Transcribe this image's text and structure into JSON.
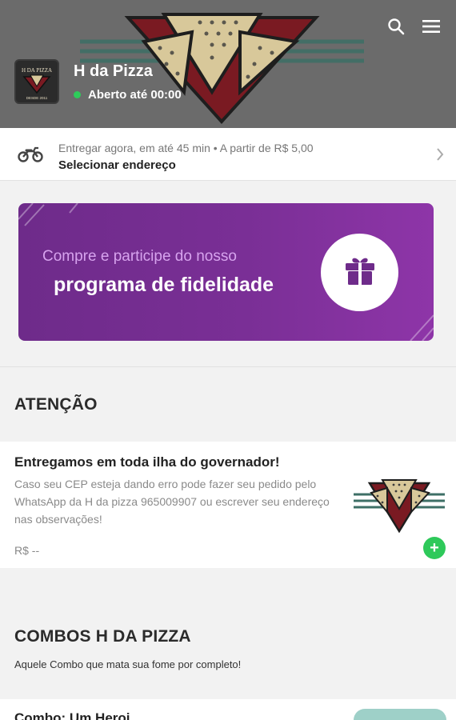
{
  "header": {
    "store_name": "H da Pizza",
    "status": "Aberto até 00:00",
    "status_color": "#2ecc5a",
    "logo_text_top": "H DA PIZZA",
    "logo_text_bottom": "DESDE 2011",
    "icons": [
      "search-icon",
      "menu-icon"
    ]
  },
  "delivery": {
    "line1": "Entregar agora, em até 45 min  •  A partir de R$ 5,00",
    "line2": "Selecionar endereço",
    "icon": "motorcycle-icon"
  },
  "banner": {
    "line1": "Compre e participe do nosso",
    "line2": "programa de fidelidade",
    "icon": "gift-icon",
    "color": "#7a2f96"
  },
  "sections": [
    {
      "title": "ATENÇÃO",
      "subtitle": "",
      "items": [
        {
          "title": "Entregamos em toda ilha do governador!",
          "description": "Caso seu CEP esteja dando erro pode fazer seu pedido pelo WhatsApp da H da pizza 965009907 ou escrever seu endereço nas observações!",
          "price": "R$ --",
          "add_label": "+"
        }
      ]
    },
    {
      "title": "COMBOS H DA PIZZA",
      "subtitle": "Aquele Combo que mata sua fome por completo!",
      "items": [
        {
          "title": "Combo: Um Heroi"
        }
      ]
    }
  ]
}
